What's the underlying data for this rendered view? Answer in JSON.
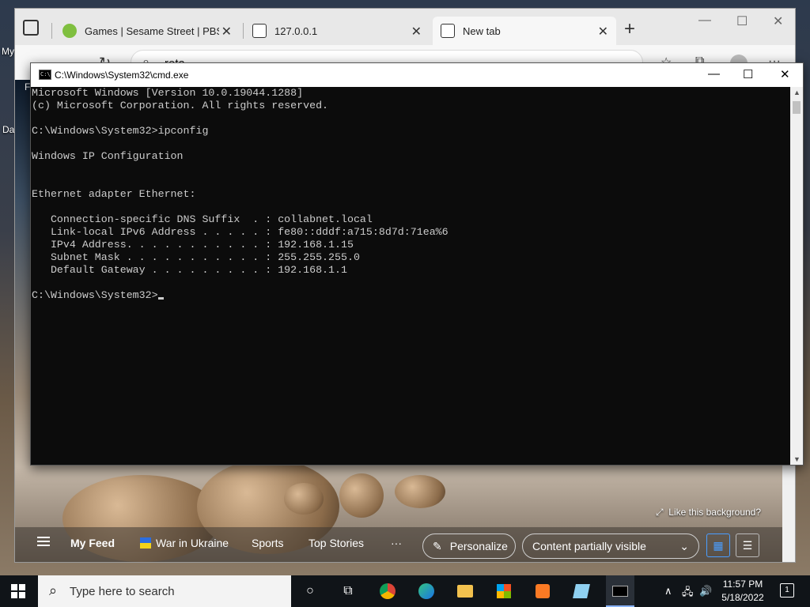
{
  "desktop": {
    "label_top": "My",
    "label_mid": "Da"
  },
  "browser": {
    "tabs": [
      {
        "title": "Games | Sesame Street | PBS KID",
        "active": false
      },
      {
        "title": "127.0.0.1",
        "active": false
      },
      {
        "title": "New tab",
        "active": true
      }
    ],
    "address_text": "reta",
    "partial_label": "F"
  },
  "ntp": {
    "like_background": "Like this background?",
    "feed": {
      "my_feed": "My Feed",
      "war_in_ukraine": "War in Ukraine",
      "sports": "Sports",
      "top_stories": "Top Stories",
      "more": "···",
      "personalize": "Personalize",
      "content_visibility": "Content partially visible"
    }
  },
  "cmd": {
    "title": "C:\\Windows\\System32\\cmd.exe",
    "lines": [
      "Microsoft Windows [Version 10.0.19044.1288]",
      "(c) Microsoft Corporation. All rights reserved.",
      "",
      "C:\\Windows\\System32>ipconfig",
      "",
      "Windows IP Configuration",
      "",
      "",
      "Ethernet adapter Ethernet:",
      "",
      "   Connection-specific DNS Suffix  . : collabnet.local",
      "   Link-local IPv6 Address . . . . . : fe80::dddf:a715:8d7d:71ea%6",
      "   IPv4 Address. . . . . . . . . . . : 192.168.1.15",
      "   Subnet Mask . . . . . . . . . . . : 255.255.255.0",
      "   Default Gateway . . . . . . . . . : 192.168.1.1",
      "",
      "C:\\Windows\\System32>"
    ]
  },
  "taskbar": {
    "search_placeholder": "Type here to search",
    "time": "11:57 PM",
    "date": "5/18/2022",
    "notification_count": "1"
  },
  "colors": {
    "cmd_bg": "#0c0c0c",
    "cmd_text": "#cccccc",
    "taskbar_bg": "#101418",
    "accent": "#4a9eff"
  }
}
